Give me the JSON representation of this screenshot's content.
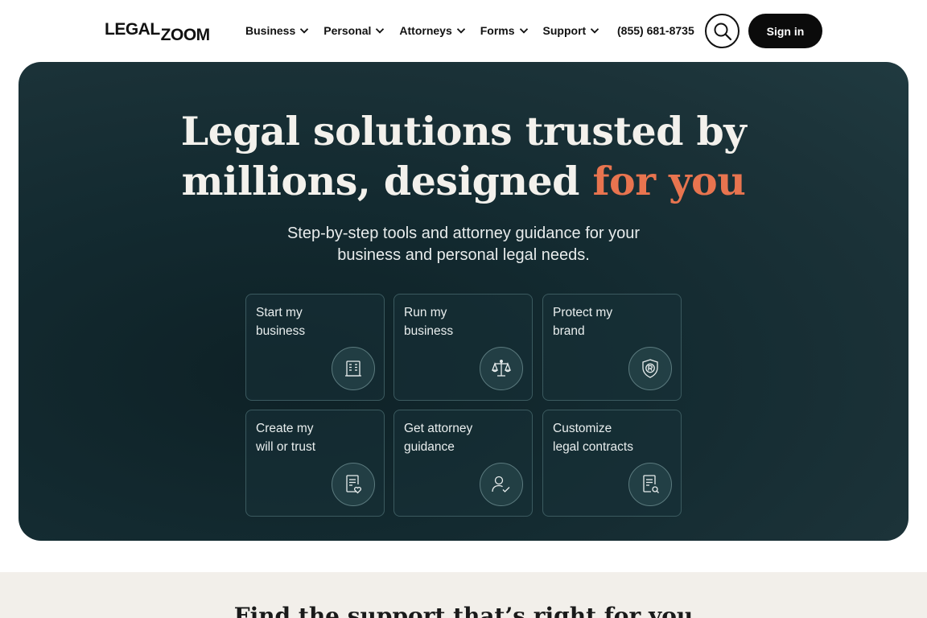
{
  "brand": {
    "logo_top": "LEGAL",
    "logo_bottom": "ZOOM"
  },
  "nav": {
    "items": [
      {
        "label": "Business"
      },
      {
        "label": "Personal"
      },
      {
        "label": "Attorneys"
      },
      {
        "label": "Forms"
      },
      {
        "label": "Support"
      }
    ],
    "phone": "(855) 681-8735",
    "search_icon": "search-icon",
    "signin_label": "Sign in"
  },
  "hero": {
    "title_line1": "Legal solutions trusted by",
    "title_line2_plain": "millions, designed ",
    "title_line2_accent": "for you",
    "subtitle_line1": "Step-by-step tools and attorney guidance for your",
    "subtitle_line2": "business and personal legal needs.",
    "cards": [
      {
        "label": "Start my\nbusiness",
        "icon": "building-document-icon"
      },
      {
        "label": "Run my\nbusiness",
        "icon": "scales-icon"
      },
      {
        "label": "Protect my\nbrand",
        "icon": "trademark-shield-icon"
      },
      {
        "label": "Create my\nwill or trust",
        "icon": "document-heart-icon"
      },
      {
        "label": "Get attorney\nguidance",
        "icon": "person-check-icon"
      },
      {
        "label": "Customize\nlegal contracts",
        "icon": "document-search-icon"
      }
    ]
  },
  "support_section": {
    "title": "Find the support that’s right for you"
  },
  "colors": {
    "hero_bg": "#132a30",
    "accent": "#e8744f",
    "signin_bg": "#0b0b0b",
    "bottom_bg": "#f2efea"
  }
}
